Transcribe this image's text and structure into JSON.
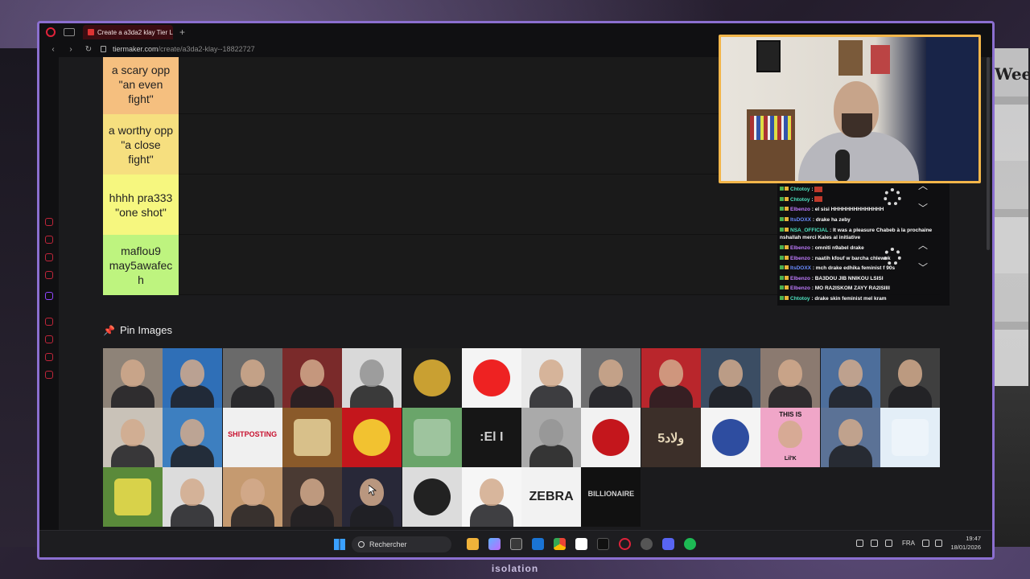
{
  "browser": {
    "tab_title": "Create a a3da2 klay Tier L",
    "tab_close": "×",
    "new_tab": "+",
    "url_domain": "tiermaker.com",
    "url_path": "/create/a3da2-klay--18822727"
  },
  "tiers": [
    {
      "label": "a scary opp\n\"an even\nfight\"",
      "color": "#f5bf7f"
    },
    {
      "label": "a worthy opp\n\"a close\nfight\"",
      "color": "#f6df7f"
    },
    {
      "label": "hhhh pra333\n\"one shot\"",
      "color": "#f6f77f"
    },
    {
      "label": "maflou9\nmay5awafec\nh",
      "color": "#bef47f"
    }
  ],
  "pin_images": {
    "heading": "Pin Images",
    "tiles": [
      {
        "bg": "#8e8378",
        "kind": "person"
      },
      {
        "bg": "#2f6fb7",
        "kind": "person"
      },
      {
        "bg": "#6a6a6a",
        "kind": "person"
      },
      {
        "bg": "#7a2a2a",
        "kind": "person"
      },
      {
        "bg": "#d9d9d9",
        "kind": "person-bw"
      },
      {
        "bg": "#1f1f1f",
        "kind": "seal"
      },
      {
        "bg": "#f4f4f4",
        "kind": "flag"
      },
      {
        "bg": "#e8e8e8",
        "kind": "person"
      },
      {
        "bg": "#6f6f70",
        "kind": "person"
      },
      {
        "bg": "#b9262c",
        "kind": "person"
      },
      {
        "bg": "#3b4d63",
        "kind": "person"
      },
      {
        "bg": "#8b7a70",
        "kind": "person"
      },
      {
        "bg": "#4d6e9b",
        "kind": "person"
      },
      {
        "bg": "#3f3f3f",
        "kind": "person"
      },
      {
        "bg": "#c9c2b8",
        "kind": "person"
      },
      {
        "bg": "#3d7fc0",
        "kind": "person"
      },
      {
        "bg": "#f0f0f0",
        "kind": "text",
        "text": "SHITPOSTING",
        "color": "#c8102e"
      },
      {
        "bg": "#8a5a2a",
        "kind": "tv"
      },
      {
        "bg": "#c4161c",
        "kind": "crest"
      },
      {
        "bg": "#6aa56a",
        "kind": "map"
      },
      {
        "bg": "#161616",
        "kind": "text",
        "text": ":El I",
        "color": "#d0d0d0"
      },
      {
        "bg": "#aaaaaa",
        "kind": "person-bw"
      },
      {
        "bg": "#f2f2f2",
        "kind": "badge"
      },
      {
        "bg": "#3c2f29",
        "kind": "text",
        "text": "ولاد5",
        "color": "#e6d7b8"
      },
      {
        "bg": "#f4f4f4",
        "kind": "logo"
      },
      {
        "bg": "#f0a6c8",
        "kind": "thisis",
        "text": "THIS IS",
        "sub": "Lil'K"
      },
      {
        "bg": "#5b7296",
        "kind": "person"
      },
      {
        "bg": "#e3eef7",
        "kind": "map"
      },
      {
        "bg": "#5a8a3a",
        "kind": "art"
      },
      {
        "bg": "#dcdcdc",
        "kind": "person"
      },
      {
        "bg": "#c59a70",
        "kind": "person"
      },
      {
        "bg": "#4a3a33",
        "kind": "person"
      },
      {
        "bg": "#282838",
        "kind": "person"
      },
      {
        "bg": "#dcdcdc",
        "kind": "mask"
      },
      {
        "bg": "#f6f6f6",
        "kind": "person"
      },
      {
        "bg": "#f2f2f2",
        "kind": "text",
        "text": "ZEBRA",
        "color": "#222222"
      },
      {
        "bg": "#111111",
        "kind": "text",
        "text": "BILLIONAIRE",
        "color": "#cfcfcf"
      }
    ]
  },
  "chat": [
    {
      "user": "Chtotoy",
      "color": "#4ee3c0",
      "msg": ""
    },
    {
      "user": "Chtotoy",
      "color": "#4ee3c0",
      "msg": ""
    },
    {
      "user": "Elbenzo",
      "color": "#c07cff",
      "msg": "el sisi HHHHHHHHHHHHHH"
    },
    {
      "user": "ItsDOXX",
      "color": "#6a8cff",
      "msg": "drake ha zeby"
    },
    {
      "user": "NSA_OFFICIAL",
      "color": "#4ee3c0",
      "msg": "It was a pleasure Chabeb à la prochaine nshallah merci Kales al initiative"
    },
    {
      "user": "Elbenzo",
      "color": "#c07cff",
      "msg": "omniti n9abel drake"
    },
    {
      "user": "Elbenzo",
      "color": "#c07cff",
      "msg": "naatih kfouf w barcha chlewek"
    },
    {
      "user": "ItsDOXX",
      "color": "#6a8cff",
      "msg": "mch drake edhika feminist f 90s"
    },
    {
      "user": "Elbenzo",
      "color": "#c07cff",
      "msg": "BA3DOU JIB NNIKOU LSISI"
    },
    {
      "user": "Elbenzo",
      "color": "#c07cff",
      "msg": "MO RA2ISKOM ZAYY RA2ISIIII"
    },
    {
      "user": "Chtotoy",
      "color": "#4ee3c0",
      "msg": "drake skin feminist mel kram"
    }
  ],
  "chat_separator": " : ",
  "taskbar": {
    "search_placeholder": "Rechercher",
    "language": "FRA",
    "time": "19:47",
    "date": "18/01/2026"
  },
  "overlay": {
    "poster_text": "Week",
    "banner_text": "isolation"
  }
}
